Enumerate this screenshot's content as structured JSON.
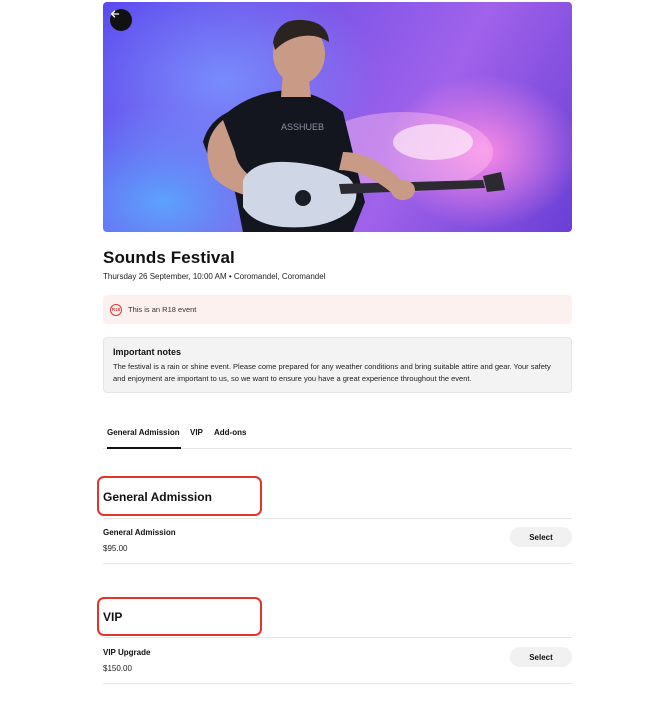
{
  "event": {
    "title": "Sounds Festival",
    "meta": "Thursday 26 September, 10:00 AM • Coromandel, Coromandel"
  },
  "notice": {
    "badge": "R18",
    "text": "This is an R18 event"
  },
  "notes": {
    "title": "Important notes",
    "body": "The festival is a rain or shine event. Please come prepared for any weather conditions and bring suitable attire and gear. Your safety and enjoyment are important to us, so we want to ensure you have a great experience throughout the event."
  },
  "tabs": [
    {
      "label": "General Admission",
      "active": true
    },
    {
      "label": "VIP",
      "active": false
    },
    {
      "label": "Add-ons",
      "active": false
    }
  ],
  "sections": [
    {
      "heading": "General Admission",
      "tickets": [
        {
          "name": "General Admission",
          "price": "$95.00",
          "button": "Select"
        }
      ]
    },
    {
      "heading": "VIP",
      "tickets": [
        {
          "name": "VIP Upgrade",
          "price": "$150.00",
          "button": "Select"
        }
      ]
    }
  ],
  "icons": {
    "back": "arrow-left-icon",
    "r18": "r18-badge-icon"
  },
  "colors": {
    "highlight": "#e4332b",
    "notice_bg": "#fdf1f0",
    "r18": "#d63b33"
  }
}
